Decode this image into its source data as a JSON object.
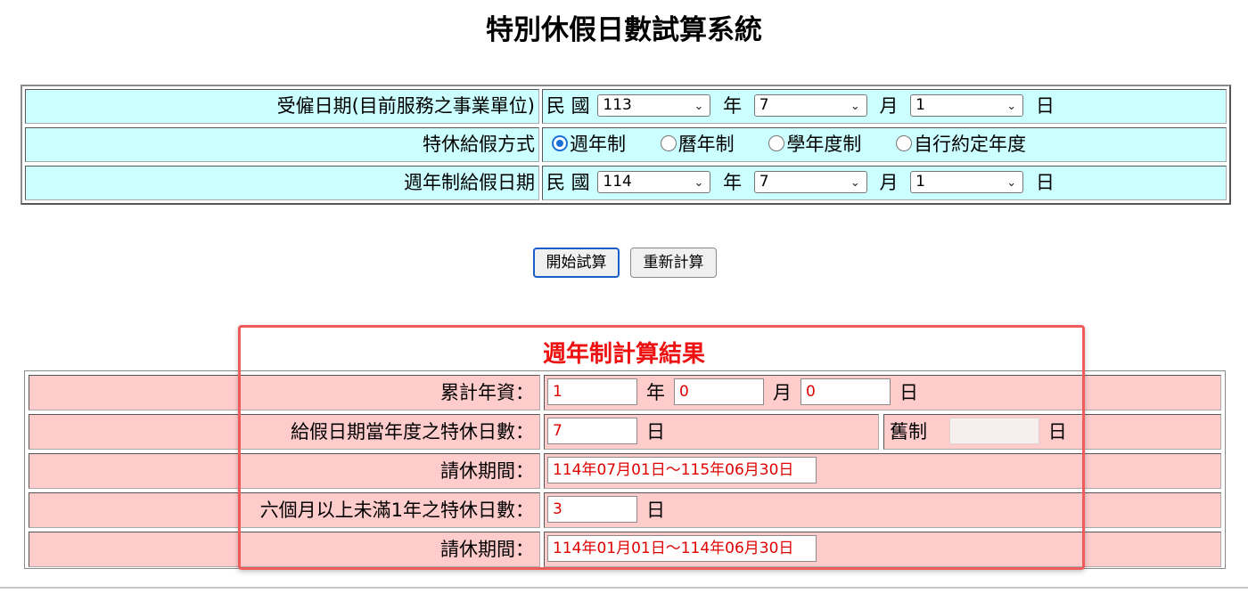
{
  "page": {
    "title": "特別休假日數試算系統"
  },
  "inputs": {
    "hire_date": {
      "label": "受僱日期(目前服務之事業單位)",
      "prefix": "民 國",
      "year": "113",
      "year_unit": "年",
      "month": "7",
      "month_unit": "月",
      "day": "1",
      "day_unit": "日"
    },
    "grant_method": {
      "label": "特休給假方式",
      "options": [
        {
          "label": "週年制",
          "checked": true
        },
        {
          "label": "曆年制",
          "checked": false
        },
        {
          "label": "學年度制",
          "checked": false
        },
        {
          "label": "自行約定年度",
          "checked": false
        }
      ]
    },
    "grant_date": {
      "label": "週年制給假日期",
      "prefix": "民 國",
      "year": "114",
      "year_unit": "年",
      "month": "7",
      "month_unit": "月",
      "day": "1",
      "day_unit": "日"
    }
  },
  "buttons": {
    "calculate": "開始試算",
    "reset": "重新計算"
  },
  "result": {
    "title": "週年制計算結果",
    "seniority": {
      "label": "累計年資：",
      "years": "1",
      "years_unit": "年",
      "months": "0",
      "months_unit": "月",
      "days": "0",
      "days_unit": "日"
    },
    "annual_leave": {
      "label": "給假日期當年度之特休日數：",
      "value": "7",
      "unit": "日",
      "old_label": "舊制",
      "old_value": "",
      "old_unit": "日"
    },
    "leave_period_1": {
      "label": "請休期間：",
      "value": "114年07月01日～115年06月30日"
    },
    "six_month_leave": {
      "label": "六個月以上未滿1年之特休日數：",
      "value": "3",
      "unit": "日"
    },
    "leave_period_2": {
      "label": "請休期間：",
      "value": "114年01月01日～114年06月30日"
    }
  },
  "colors": {
    "input_row_bg": "#ccffff",
    "result_row_bg": "#ffcccc",
    "result_title": "#ee1111",
    "highlight_border": "#ef5a5a",
    "primary_button_border": "#1a5fc9"
  }
}
